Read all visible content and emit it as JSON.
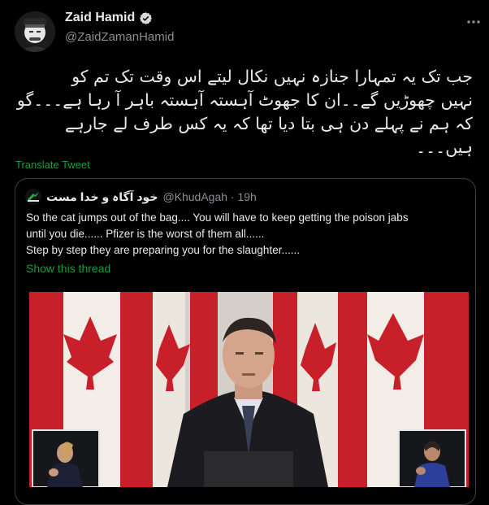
{
  "author": {
    "name": "Zaid Hamid",
    "handle": "@ZaidZamanHamid"
  },
  "tweet": {
    "lines": [
      "جب تک یہ تمہارا جنازہ نہیں نکال لیتے اس وقت تک تم کو",
      "نہیں چھوڑیں گے۔۔ان کا جھوٹ آہستہ آہستہ باہر آ رہا ہے۔۔۔گو",
      "کہ ہم نے پہلے دن ہی بتا دیا تھا کہ یہ کس طرف لے جارہے",
      "ہیں۔۔۔"
    ],
    "translate_label": "Translate Tweet"
  },
  "quote": {
    "name": "خود آگاہ و خدا مست",
    "handle_time": "@KhudAgah · 19h",
    "lines": [
      "So the cat jumps out of the bag.... You will have to keep getting the poison jabs",
      "until you die...... Pfizer is the worst of them all......",
      "Step by step they are preparing you for the slaughter......"
    ],
    "show_thread": "Show this thread"
  },
  "colors": {
    "background": "#000000",
    "link_green": "#1d9b3f",
    "flag_red": "#c8202a"
  },
  "icons": {
    "verified": "verified-badge-icon",
    "more": "more-options-icon"
  }
}
